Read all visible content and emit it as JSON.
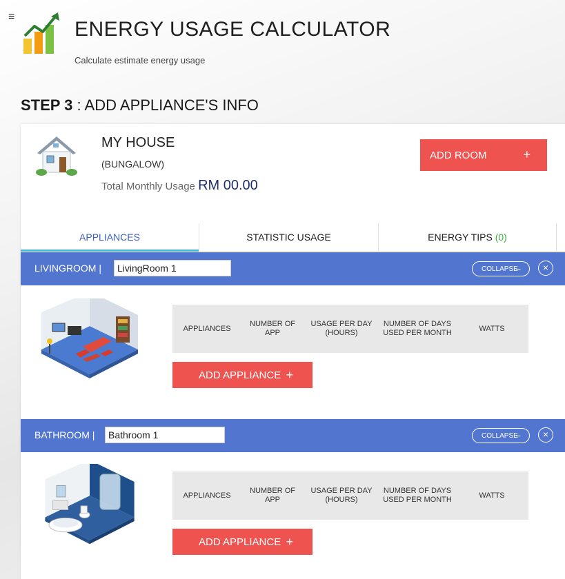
{
  "app": {
    "title": "ENERGY USAGE CALCULATOR",
    "subtitle": "Calculate estimate energy usage",
    "menu_icon": "≡"
  },
  "step": {
    "label": "STEP 3",
    "text": " : ADD APPLIANCE'S INFO"
  },
  "house": {
    "name": "MY HOUSE",
    "type": "(BUNGALOW)",
    "usage_label": "Total Monthly Usage ",
    "usage_value": "RM 00.00",
    "add_room_label": "ADD ROOM",
    "add_room_icon": "+"
  },
  "tabs": {
    "appliances": "APPLIANCES",
    "statistic": "STATISTIC USAGE",
    "tips_label": "ENERGY TIPS ",
    "tips_count": "(0)"
  },
  "rooms": [
    {
      "type_label": "LIVINGROOM | ",
      "name_value": "LivingRoom 1",
      "collapse_label": "COLLAPSE",
      "collapse_icon": "−",
      "close_icon": "×",
      "columns": [
        "APPLIANCES",
        "NUMBER OF APP",
        "USAGE PER DAY (HOURS)",
        "NUMBER OF DAYS USED PER MONTH",
        "WATTS"
      ],
      "add_label": "ADD APPLIANCE",
      "add_icon": "+"
    },
    {
      "type_label": "BATHROOM | ",
      "name_value": "Bathroom 1",
      "collapse_label": "COLLAPSE",
      "collapse_icon": "−",
      "close_icon": "×",
      "columns": [
        "APPLIANCES",
        "NUMBER OF APP",
        "USAGE PER DAY (HOURS)",
        "NUMBER OF DAYS USED PER MONTH",
        "WATTS"
      ],
      "add_label": "ADD APPLIANCE",
      "add_icon": "+"
    }
  ],
  "colors": {
    "accent_red": "#ef5350",
    "room_header_blue": "#5275cf",
    "active_tab_underline": "#4bb6d9",
    "usage_value": "#1f2d6b",
    "tips_count": "#3fae3f"
  }
}
